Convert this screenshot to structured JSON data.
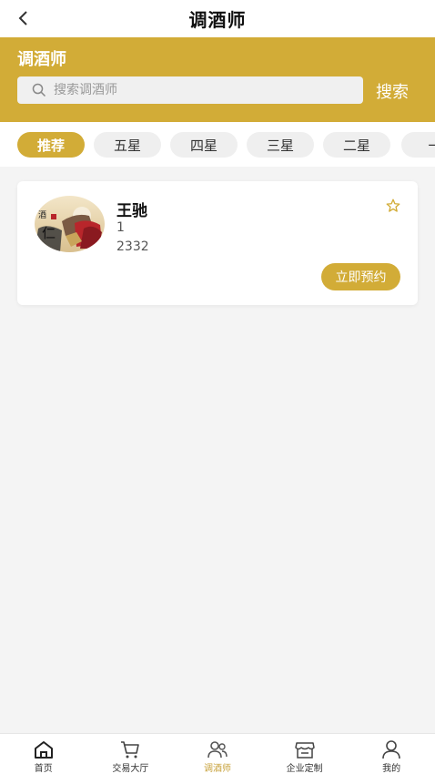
{
  "nav": {
    "title": "调酒师"
  },
  "banner": {
    "title": "调酒师",
    "search_placeholder": "搜索调酒师",
    "search_label": "搜索"
  },
  "filters": [
    {
      "label": "推荐",
      "active": true
    },
    {
      "label": "五星",
      "active": false
    },
    {
      "label": "四星",
      "active": false
    },
    {
      "label": "三星",
      "active": false
    },
    {
      "label": "二星",
      "active": false
    },
    {
      "label": "一",
      "active": false
    }
  ],
  "bartenders": [
    {
      "name": "王驰",
      "level": "1",
      "count": "2332",
      "book_label": "立即预约"
    }
  ],
  "tabbar": [
    {
      "label": "首页",
      "icon": "home-icon",
      "active": false
    },
    {
      "label": "交易大厅",
      "icon": "cart-icon",
      "active": false
    },
    {
      "label": "调酒师",
      "icon": "users-icon",
      "active": true
    },
    {
      "label": "企业定制",
      "icon": "store-icon",
      "active": false
    },
    {
      "label": "我的",
      "icon": "user-icon",
      "active": false
    }
  ],
  "colors": {
    "accent": "#d2ac37",
    "tab_active": "#c7a13a",
    "background": "#f4f4f4"
  }
}
